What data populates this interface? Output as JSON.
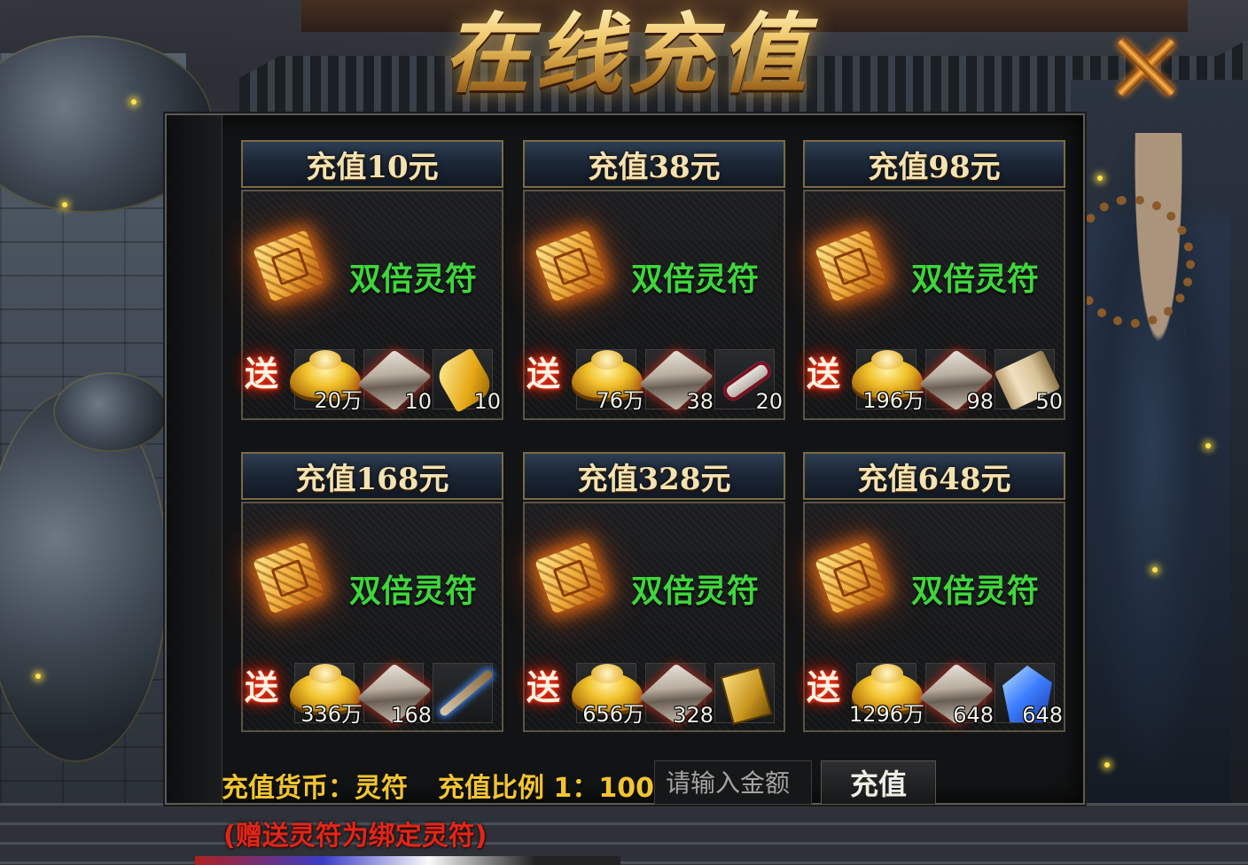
{
  "title": "在线充值",
  "double_label": "双倍灵符",
  "gift_label": "送",
  "cards": [
    {
      "label": "充值10元",
      "gold": "20万",
      "blade": "10",
      "extra": "10",
      "extra_icon": "gold-scroll-icon"
    },
    {
      "label": "充值38元",
      "gold": "76万",
      "blade": "38",
      "extra": "20",
      "extra_icon": "red-scroll-icon"
    },
    {
      "label": "充值98元",
      "gold": "196万",
      "blade": "98",
      "extra": "50",
      "extra_icon": "paper-scroll-icon"
    },
    {
      "label": "充值168元",
      "gold": "336万",
      "blade": "168",
      "extra": "",
      "extra_icon": "brush-icon"
    },
    {
      "label": "充值328元",
      "gold": "656万",
      "blade": "328",
      "extra": "",
      "extra_icon": "golden-book-icon"
    },
    {
      "label": "充值648元",
      "gold": "1296万",
      "blade": "648",
      "extra": "648",
      "extra_icon": "blue-crystal-icon"
    }
  ],
  "currency_text": "充值货币：灵符",
  "ratio_text": "充值比例 1：100",
  "amount_placeholder": "请输入金额",
  "pay_button": "充值",
  "note": "(赠送灵符为绑定灵符)",
  "colors": {
    "accent_gold": "#f2c530",
    "double_green": "#3fd63c",
    "note_red": "#e0261a"
  }
}
